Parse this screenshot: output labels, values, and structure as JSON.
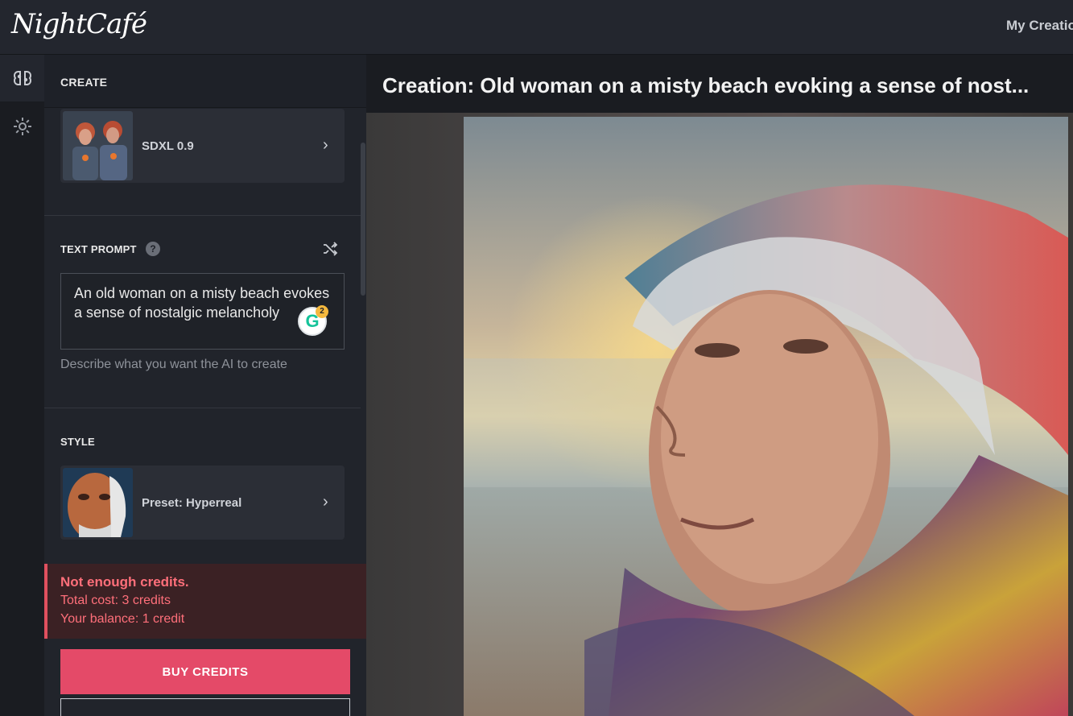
{
  "app": {
    "logo_text": "NightCafé",
    "top_nav_link": "My Creatio"
  },
  "sidebar": {
    "rail_icons": [
      "brain-icon",
      "gear-icon"
    ],
    "create_label": "CREATE"
  },
  "model": {
    "name": "SDXL 0.9"
  },
  "prompt": {
    "title": "TEXT PROMPT",
    "help_glyph": "?",
    "value": "An old woman on a misty beach evokes a sense of nostalgic melancholy",
    "hint": "Describe what you want the AI to create",
    "grammarly_letter": "G",
    "grammarly_count": "2"
  },
  "style": {
    "title": "STYLE",
    "preset": "Preset: Hyperreal"
  },
  "alert": {
    "title": "Not enough credits.",
    "total_cost": "Total cost: 3 credits",
    "balance": "Your balance: 1 credit"
  },
  "actions": {
    "buy_credits": "BUY CREDITS"
  },
  "creation": {
    "title": "Creation: Old woman on a misty beach evoking a sense of nost..."
  },
  "colors": {
    "accent": "#e44a68",
    "alert_text": "#ff6f7a",
    "panel_bg": "#21242b"
  }
}
